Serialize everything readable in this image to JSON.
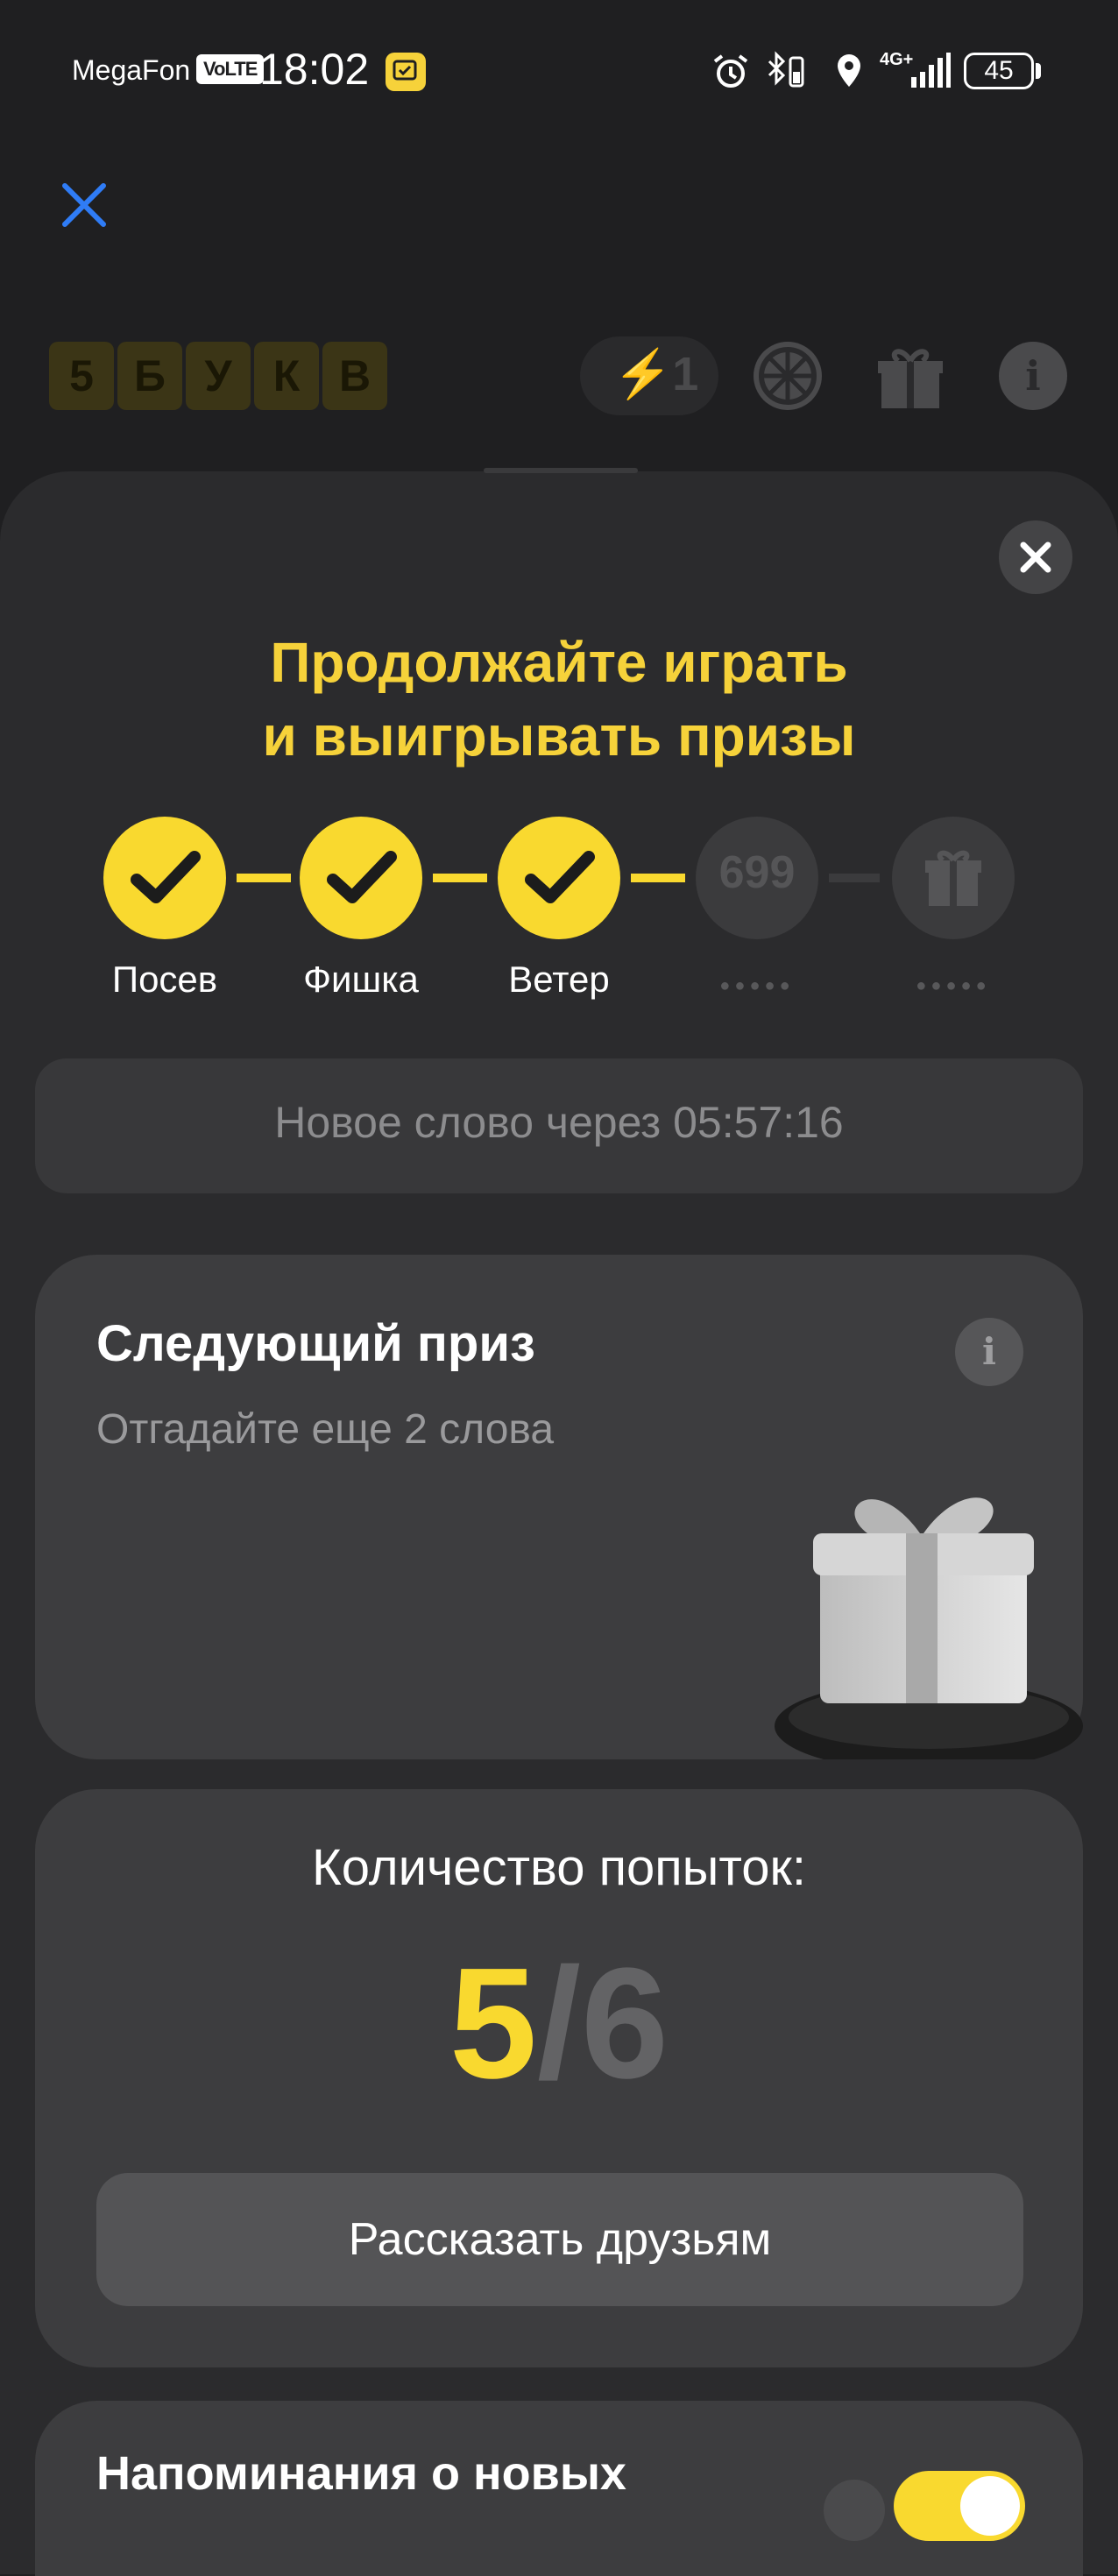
{
  "status_bar": {
    "carrier": "MegaFon",
    "volte": "VoLTE",
    "time": "18:02",
    "network": "4G+",
    "battery": "45"
  },
  "header": {
    "logo_letters": [
      "5",
      "Б",
      "У",
      "К",
      "В"
    ],
    "boosts": "⚡1"
  },
  "sheet": {
    "title_line1": "Продолжайте играть",
    "title_line2": "и выигрывать призы",
    "steps": [
      {
        "label": "Посев",
        "state": "done"
      },
      {
        "label": "Фишка",
        "state": "done"
      },
      {
        "label": "Ветер",
        "state": "done"
      },
      {
        "label": "●●●●●",
        "state": "locked",
        "value": "699"
      },
      {
        "label": "●●●●●",
        "state": "locked",
        "icon": "gift-icon"
      }
    ],
    "timer_text": "Новое слово через 05:57:16",
    "next_prize": {
      "title": "Следующий приз",
      "subtitle": "Отгадайте еще 2 слова"
    },
    "attempts": {
      "label": "Количество попыток:",
      "current": "5",
      "separator": "/",
      "total": "6",
      "share_button": "Рассказать друзьям"
    },
    "reminders": {
      "label": "Напоминания о новых"
    }
  },
  "colors": {
    "accent_yellow": "#f9d92f",
    "title_yellow": "#f6d23a",
    "background": "#1f1f21",
    "sheet": "#2b2b2d",
    "card": "#3d3d3f",
    "close_blue": "#2f7cf6"
  }
}
